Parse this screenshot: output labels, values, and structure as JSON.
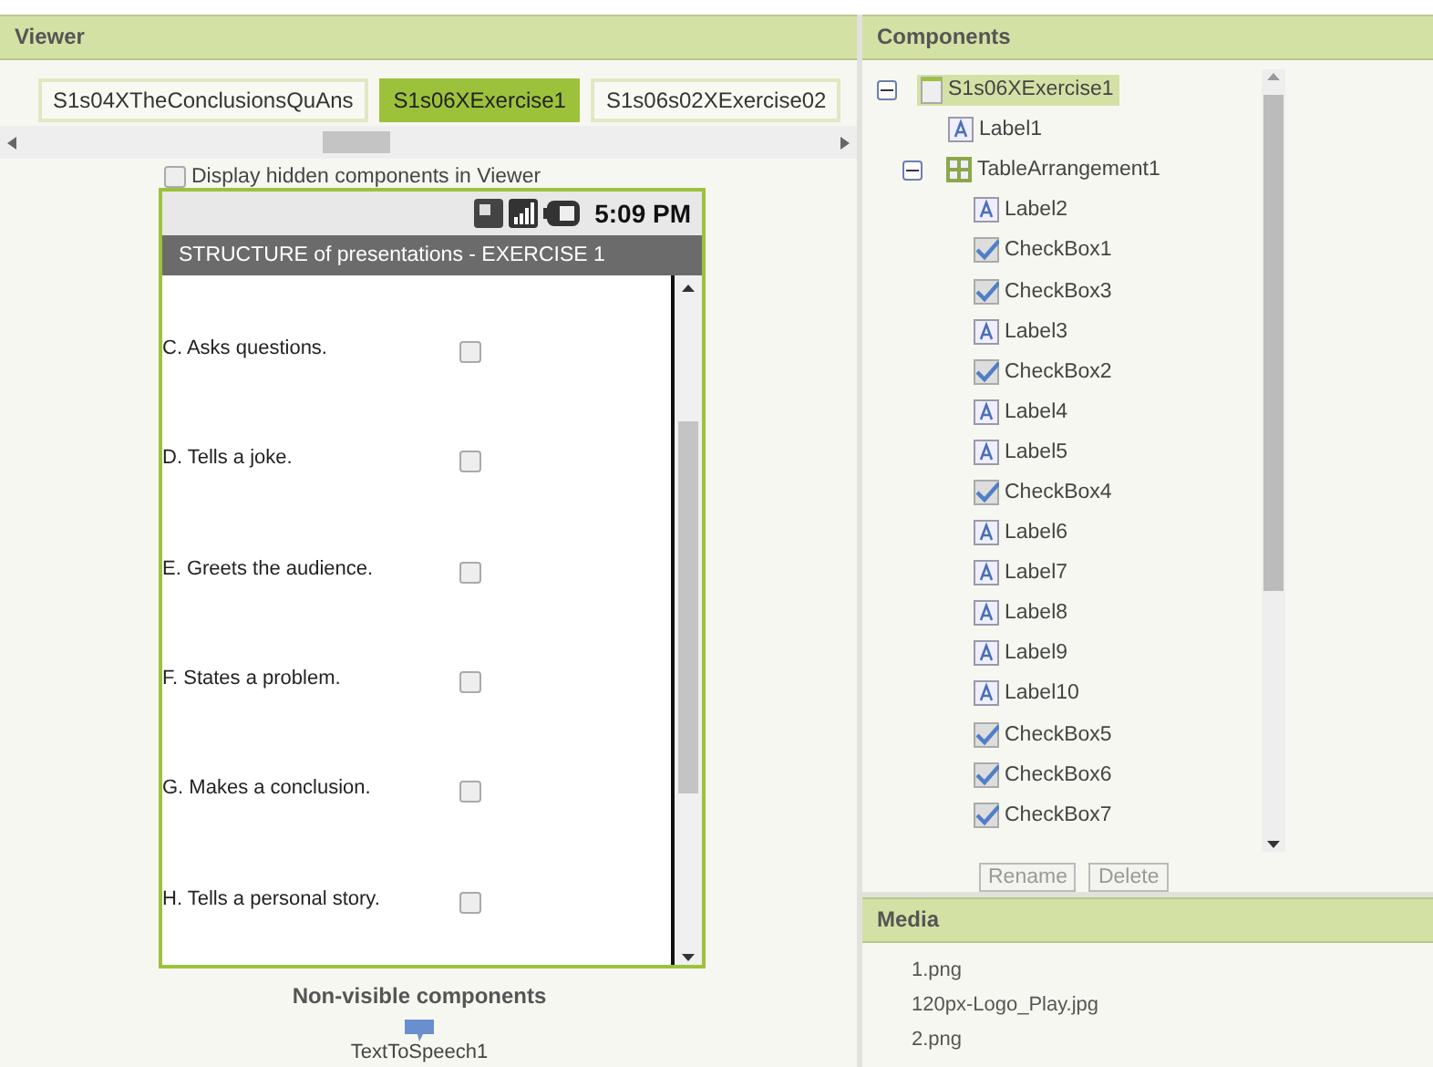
{
  "viewer": {
    "title": "Viewer",
    "tabs": [
      {
        "label": "S1s04XTheConclusionsQuAns",
        "selected": false
      },
      {
        "label": "S1s06XExercise1",
        "selected": true
      },
      {
        "label": "S1s06s02XExercise02",
        "selected": false
      }
    ],
    "hidden_toggle": {
      "label": "Display hidden components in Viewer",
      "checked": false
    },
    "phone": {
      "time": "5:09 PM",
      "title": "STRUCTURE of presentations - EXERCISE 1",
      "items": [
        {
          "label": "C. Asks questions.",
          "checked": false
        },
        {
          "label": "D. Tells a joke.",
          "checked": false
        },
        {
          "label": "E. Greets the audience.",
          "checked": false
        },
        {
          "label": "F. States a problem.",
          "checked": false
        },
        {
          "label": "G. Makes a conclusion.",
          "checked": false
        },
        {
          "label": "H. Tells a personal story.",
          "checked": false
        }
      ]
    },
    "nonvisible": {
      "title": "Non-visible components",
      "items": [
        "TextToSpeech1"
      ]
    }
  },
  "components": {
    "title": "Components",
    "tree": [
      {
        "kind": "screen",
        "label": "S1s06XExercise1",
        "selected": true,
        "expanded": true,
        "children": [
          {
            "kind": "label",
            "label": "Label1",
            "selected": false
          },
          {
            "kind": "table",
            "label": "TableArrangement1",
            "selected": false,
            "expanded": true,
            "children": [
              {
                "kind": "label",
                "label": "Label2",
                "selected": false
              },
              {
                "kind": "checkbox",
                "label": "CheckBox1",
                "selected": false
              },
              {
                "kind": "checkbox",
                "label": "CheckBox3",
                "selected": false
              },
              {
                "kind": "label",
                "label": "Label3",
                "selected": false
              },
              {
                "kind": "checkbox",
                "label": "CheckBox2",
                "selected": false
              },
              {
                "kind": "label",
                "label": "Label4",
                "selected": false
              },
              {
                "kind": "label",
                "label": "Label5",
                "selected": false
              },
              {
                "kind": "checkbox",
                "label": "CheckBox4",
                "selected": false
              },
              {
                "kind": "label",
                "label": "Label6",
                "selected": false
              },
              {
                "kind": "label",
                "label": "Label7",
                "selected": false
              },
              {
                "kind": "label",
                "label": "Label8",
                "selected": false
              },
              {
                "kind": "label",
                "label": "Label9",
                "selected": false
              },
              {
                "kind": "label",
                "label": "Label10",
                "selected": false
              },
              {
                "kind": "checkbox",
                "label": "CheckBox5",
                "selected": false
              },
              {
                "kind": "checkbox",
                "label": "CheckBox6",
                "selected": false
              },
              {
                "kind": "checkbox",
                "label": "CheckBox7",
                "selected": false
              }
            ]
          }
        ]
      }
    ],
    "buttons": [
      {
        "label": "Rename",
        "disabled": true
      },
      {
        "label": "Delete",
        "disabled": true
      }
    ]
  },
  "media": {
    "title": "Media",
    "files": [
      "1.png",
      "120px-Logo_Play.jpg",
      "2.png"
    ]
  }
}
